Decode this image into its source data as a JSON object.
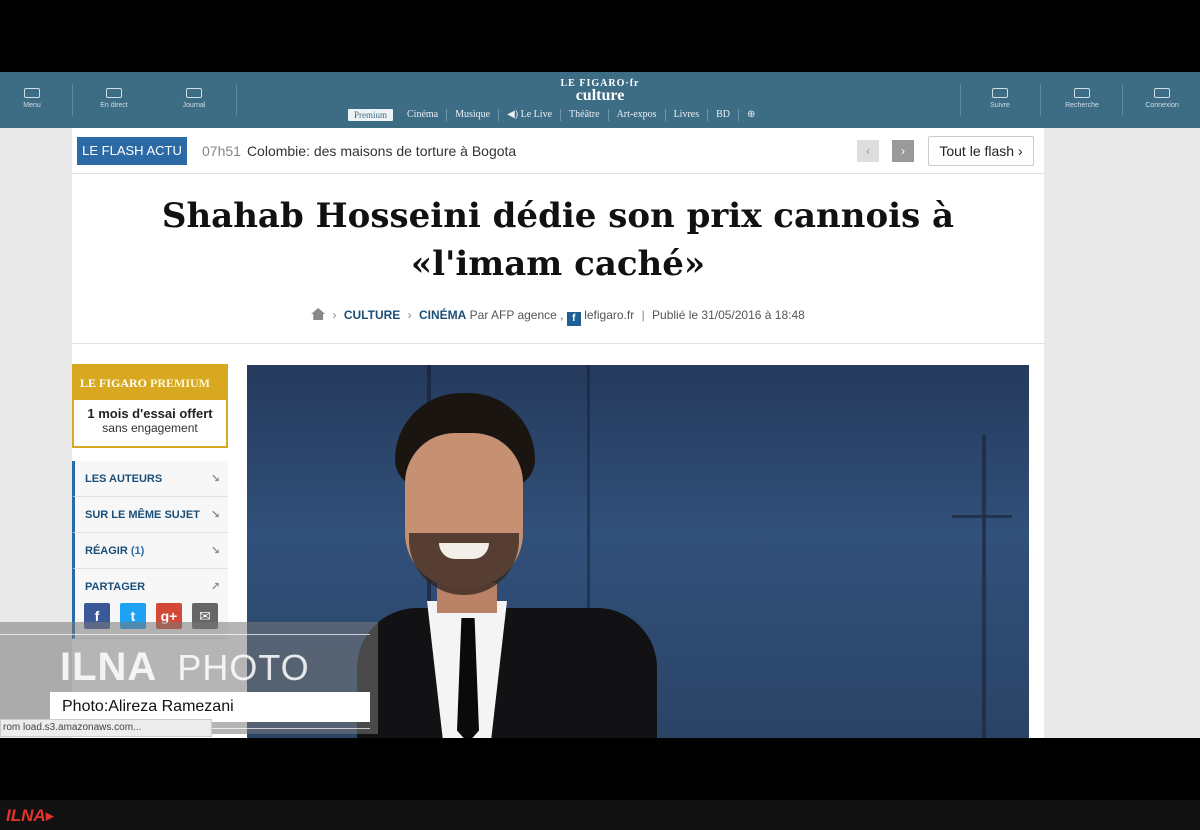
{
  "topbar": {
    "left_items": [
      "Menu",
      "En direct",
      "Journal"
    ],
    "right_items": [
      "Suivre",
      "Recherche",
      "Connexion"
    ],
    "brand_line1": "LE FIGARO·fr",
    "brand_line2": "culture",
    "nav": [
      "Premium",
      "Cinéma",
      "Musique",
      "◀) Le Live",
      "Théâtre",
      "Art-expos",
      "Livres",
      "BD",
      "⊕"
    ]
  },
  "flash": {
    "badge": "LE FLASH ACTU",
    "time": "07h51",
    "text": "Colombie: des maisons de torture à Bogota",
    "prev": "‹",
    "next": "›",
    "all_label": "Tout le flash ›"
  },
  "article": {
    "title_line1": "Shahab Hosseini dédie son prix cannois à",
    "title_line2": "«l'imam caché»",
    "crumb1": "CULTURE",
    "crumb2": "CINÉMA",
    "author": "Par AFP agence ,",
    "source_icon": "f",
    "source": "lefigaro.fr",
    "published": "Publié le 31/05/2016 à 18:48"
  },
  "premium": {
    "brand1": "LE FIGARO",
    "brand2": "PREMIUM",
    "offer": "1 mois d'essai offert",
    "sub": "sans engagement"
  },
  "sidebar": {
    "items": [
      {
        "label": "LES AUTEURS",
        "count": ""
      },
      {
        "label": "SUR LE MÊME SUJET",
        "count": ""
      },
      {
        "label": "RÉAGIR",
        "count": "(1)"
      },
      {
        "label": "PARTAGER",
        "count": ""
      }
    ],
    "arrow": "↘",
    "share_arrow": "↗",
    "share": [
      "f",
      "t",
      "g+",
      "✉"
    ]
  },
  "watermark": {
    "brand": "ILNA",
    "photo": "PHOTO",
    "credit": "Photo:Alireza Ramezani"
  },
  "status_text": "rom load.s3.amazonaws.com...",
  "bottom_logo": "ILNA▸"
}
